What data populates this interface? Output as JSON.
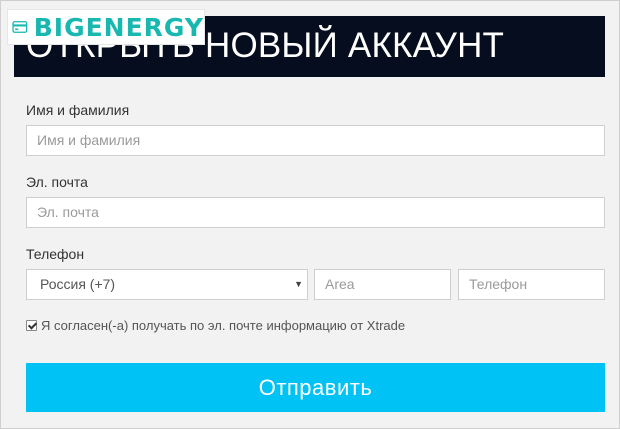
{
  "watermark": {
    "brand_text": "BIGENERGY",
    "brand_color": "#18b8b0",
    "icon": "wallet-card-icon"
  },
  "header": {
    "title": "ОТКРЫТЬ НОВЫЙ АККАУНТ",
    "background": "#050d1e"
  },
  "form": {
    "name": {
      "label": "Имя и фамилия",
      "placeholder": "Имя и фамилия"
    },
    "email": {
      "label": "Эл. почта",
      "placeholder": "Эл. почта"
    },
    "phone": {
      "label": "Телефон",
      "country_selected": "Россия (+7)",
      "country_arrow": "▼",
      "area_placeholder": "Area",
      "number_placeholder": "Телефон"
    },
    "consent": {
      "checked": true,
      "text": "Я согласен(-а) получать по эл. почте информацию от Xtrade"
    },
    "submit": {
      "label": "Отправить",
      "color": "#00c2f5"
    }
  }
}
